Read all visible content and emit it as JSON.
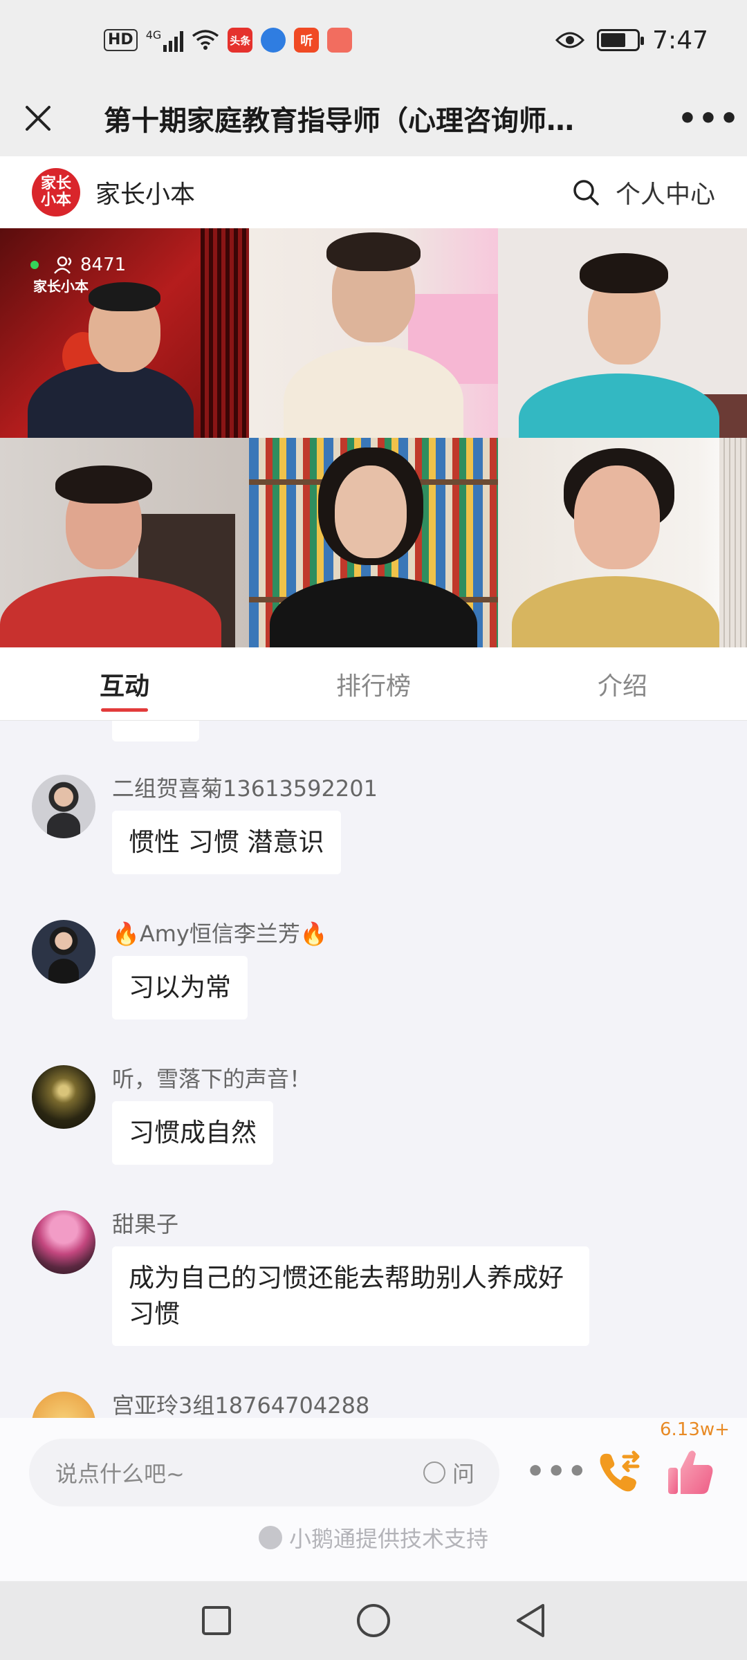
{
  "status_bar": {
    "network_badge": "HD",
    "signal_label": "4G",
    "app_badges": [
      "头条",
      "听"
    ],
    "time": "7:47",
    "battery_percent": 70
  },
  "title_bar": {
    "title": "第十期家庭教育指导师（心理咨询师…",
    "more": "•••"
  },
  "brand_bar": {
    "logo_text": "家长小本",
    "name": "家长小本",
    "personal_center": "个人中心"
  },
  "live": {
    "viewer_count": "8471",
    "watermark": "家长小本"
  },
  "tabs": [
    {
      "label": "互动",
      "active": true
    },
    {
      "label": "排行榜",
      "active": false
    },
    {
      "label": "介绍",
      "active": false
    }
  ],
  "messages": [
    {
      "nickname": "二组贺喜菊13613592201",
      "text": "惯性 习惯 潜意识"
    },
    {
      "nickname": "🔥Amy恒信李兰芳🔥",
      "text": "习以为常"
    },
    {
      "nickname": "听，雪落下的声音！",
      "text": "习惯成自然"
    },
    {
      "nickname": "甜果子",
      "text": "成为自己的习惯还能去帮助别人养成好习惯"
    },
    {
      "nickname": "宫亚玲3组18764704288",
      "text": ""
    }
  ],
  "input": {
    "placeholder": "说点什么吧~",
    "ask_label": "问"
  },
  "like_count": "6.13w+",
  "support_text": "小鹅通提供技术支持",
  "colors": {
    "accent_red": "#e23b3b",
    "brand_red": "#d9252b",
    "like_orange": "#e88a25"
  }
}
